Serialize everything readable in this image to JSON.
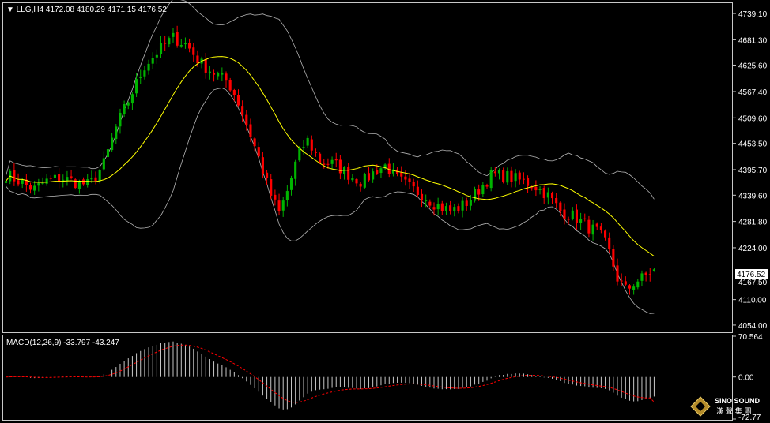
{
  "colors": {
    "background": "#000000",
    "frame": "#c8c8c8",
    "bull": "#00b400",
    "bear": "#ff0000",
    "ma": "#ffff00",
    "bands": "#b4b4b4",
    "macd_hist": "#c8c8c8",
    "macd_signal": "#ff0000",
    "price_tag_bg": "#ffffff",
    "price_tag_fg": "#000000"
  },
  "main": {
    "header": "▼ LLG,H4  4172.08 4180.29 4171.15 4176.52",
    "price_tag": "4176.52",
    "partially_hidden_label": "4167.50",
    "axis_labels": [
      "4739.10",
      "4681.30",
      "4625.60",
      "4567.40",
      "4509.60",
      "4453.50",
      "4395.70",
      "4339.60",
      "4281.80",
      "4224.00",
      "4110.00",
      "4054.00"
    ]
  },
  "macd": {
    "header": "MACD(12,26,9) -33.797 -43.247",
    "axis_labels": [
      "70.564",
      "0.00",
      "-72.77"
    ]
  },
  "logo": {
    "name": "SINO SOUND",
    "cn": "漢 聲 集 團"
  },
  "chart_data": [
    {
      "type": "candlestick",
      "title": "LLG,H4",
      "last_bar": {
        "open": 4172.08,
        "high": 4180.29,
        "low": 4171.15,
        "close": 4176.52
      },
      "ylim": [
        4040,
        4760
      ],
      "bar_count": 160,
      "close_path": [
        [
          0,
          4385
        ],
        [
          6,
          4370
        ],
        [
          12,
          4352
        ],
        [
          18,
          4372
        ],
        [
          24,
          4378
        ],
        [
          30,
          4368
        ],
        [
          36,
          4362
        ],
        [
          42,
          4405
        ],
        [
          48,
          4495
        ],
        [
          54,
          4560
        ],
        [
          60,
          4625
        ],
        [
          66,
          4658
        ],
        [
          72,
          4686
        ],
        [
          78,
          4670
        ],
        [
          84,
          4630
        ],
        [
          90,
          4608
        ],
        [
          96,
          4588
        ],
        [
          100,
          4548
        ],
        [
          104,
          4495
        ],
        [
          110,
          4410
        ],
        [
          114,
          4345
        ],
        [
          118,
          4300
        ],
        [
          122,
          4355
        ],
        [
          126,
          4425
        ],
        [
          130,
          4462
        ],
        [
          136,
          4412
        ],
        [
          142,
          4408
        ],
        [
          148,
          4385
        ],
        [
          154,
          4368
        ],
        [
          160,
          4395
        ],
        [
          164,
          4405
        ],
        [
          168,
          4380
        ],
        [
          174,
          4358
        ],
        [
          180,
          4340
        ],
        [
          186,
          4318
        ],
        [
          192,
          4305
        ],
        [
          198,
          4318
        ],
        [
          204,
          4350
        ],
        [
          210,
          4385
        ],
        [
          216,
          4382
        ],
        [
          222,
          4372
        ],
        [
          228,
          4362
        ],
        [
          234,
          4340
        ],
        [
          240,
          4302
        ],
        [
          246,
          4292
        ],
        [
          252,
          4268
        ],
        [
          256,
          4258
        ],
        [
          260,
          4225
        ],
        [
          264,
          4158
        ],
        [
          268,
          4130
        ],
        [
          272,
          4150
        ],
        [
          276,
          4160
        ],
        [
          280,
          4176.52
        ]
      ],
      "indicators": [
        "Moving Average",
        "Bollinger Bands"
      ]
    },
    {
      "type": "macd",
      "title": "MACD(12,26,9)",
      "macd": -33.797,
      "signal": -43.247,
      "ylim": [
        -72.77,
        70.564
      ]
    }
  ]
}
